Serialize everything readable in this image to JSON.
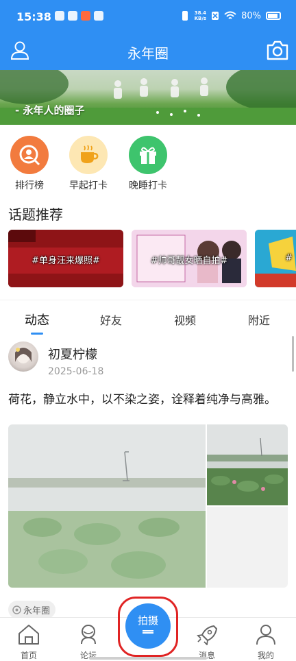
{
  "status": {
    "time": "15:38",
    "net_speed_value": "38.4",
    "net_speed_unit": "KB/s",
    "battery": "80%"
  },
  "app": {
    "title": "永年圈"
  },
  "banner": {
    "text": "- 永年人的圈子"
  },
  "quick_actions": [
    {
      "label": "排行榜",
      "icon": "ranking-icon",
      "color": "#f27b3e"
    },
    {
      "label": "早起打卡",
      "icon": "coffee-cup-icon",
      "color": "#fde7b3"
    },
    {
      "label": "晚睡打卡",
      "icon": "gift-icon",
      "color": "#3ec46d"
    }
  ],
  "topics": {
    "title": "话题推荐",
    "items": [
      {
        "label": "#单身汪来爆照#"
      },
      {
        "label": "#帅哥靓女晒自拍#"
      },
      {
        "label": "#"
      }
    ]
  },
  "tabs": [
    {
      "label": "动态",
      "active": true
    },
    {
      "label": "好友"
    },
    {
      "label": "视频"
    },
    {
      "label": "附近"
    }
  ],
  "post": {
    "author": "初夏柠檬",
    "date": "2025-06-18",
    "text": "荷花，静立水中，以不染之姿，诠释着纯净与高雅。",
    "tag": "永年圈"
  },
  "nav": {
    "home": "首页",
    "forum": "论坛",
    "capture": "拍摄",
    "messages": "消息",
    "me": "我的"
  },
  "colors": {
    "primary": "#2f8ff3",
    "highlight_ring": "#e02424"
  }
}
